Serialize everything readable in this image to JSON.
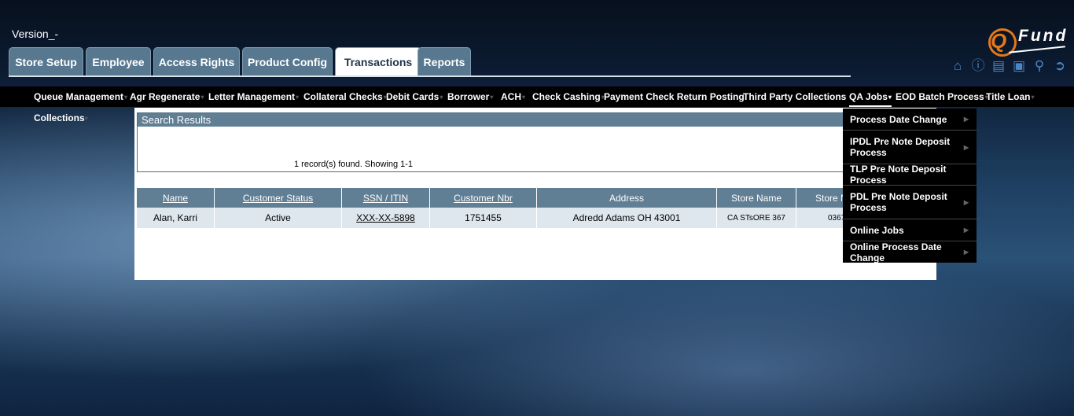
{
  "header": {
    "version": "Version_-"
  },
  "logo": {
    "q": "Q",
    "text": "Fund"
  },
  "tabs": [
    {
      "label": "Store Setup"
    },
    {
      "label": "Employee"
    },
    {
      "label": "Access Rights"
    },
    {
      "label": "Product Config"
    },
    {
      "label": "Transactions",
      "active": true
    },
    {
      "label": "Reports"
    }
  ],
  "toolbar_icons": [
    "home-icon",
    "info-icon",
    "notes-icon",
    "lock-icon",
    "search-icon",
    "logout-icon"
  ],
  "menu": {
    "items": [
      {
        "label": "Queue Management"
      },
      {
        "label": "Agr Regenerate"
      },
      {
        "label": "Letter Management"
      },
      {
        "label": "Collateral Checks"
      },
      {
        "label": "Debit Cards"
      },
      {
        "label": "Borrower"
      },
      {
        "label": "ACH"
      },
      {
        "label": "Check Cashing"
      },
      {
        "label": "Payment Check Return Posting"
      },
      {
        "label": "Third Party Collections"
      },
      {
        "label": "QA Jobs"
      },
      {
        "label": "EOD Batch Process"
      },
      {
        "label": "Title Loan"
      },
      {
        "label": "Collections"
      }
    ],
    "qa_jobs_submenu": [
      {
        "label": "Process Date Change"
      },
      {
        "label": "IPDL Pre Note Deposit Process"
      },
      {
        "label": "TLP Pre Note Deposit Process"
      },
      {
        "label": "PDL Pre Note Deposit Process"
      },
      {
        "label": "Online Jobs"
      },
      {
        "label": "Online Process Date Change"
      }
    ]
  },
  "search_results": {
    "title": "Search Results",
    "count_text": "1 record(s) found. Showing 1-1"
  },
  "table": {
    "headers": [
      "Name",
      "Customer Status",
      "SSN / ITIN",
      "Customer Nbr",
      "Address",
      "Store Name",
      "Store N"
    ],
    "rows": [
      [
        "Alan, Karri",
        "Active",
        "XXX-XX-5898",
        "1751455",
        "Adredd Adams OH 43001",
        "CA STsORE 367",
        "0367"
      ]
    ]
  },
  "colors": {
    "accent_orange": "#e3781b",
    "icon_blue": "#4a86c5",
    "header_slate": "#607e94",
    "row_bg": "#dfe7ee"
  }
}
